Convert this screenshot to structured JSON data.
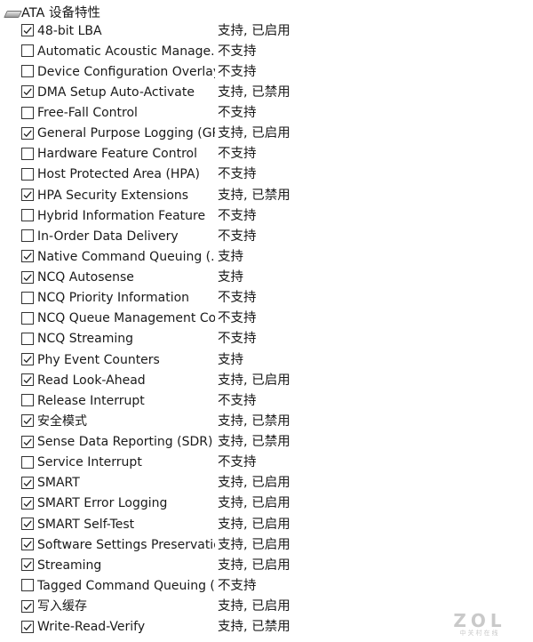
{
  "header": {
    "icon": "drive-icon",
    "title": "ATA 设备特性"
  },
  "features": [
    {
      "name": "48-bit LBA",
      "checked": true,
      "status": "支持, 已启用"
    },
    {
      "name": "Automatic Acoustic Manage...",
      "checked": false,
      "status": "不支持"
    },
    {
      "name": "Device Configuration Overlay...",
      "checked": false,
      "status": "不支持"
    },
    {
      "name": "DMA Setup Auto-Activate",
      "checked": true,
      "status": "支持, 已禁用"
    },
    {
      "name": "Free-Fall Control",
      "checked": false,
      "status": "不支持"
    },
    {
      "name": "General Purpose Logging (GP...",
      "checked": true,
      "status": "支持, 已启用"
    },
    {
      "name": "Hardware Feature Control",
      "checked": false,
      "status": "不支持"
    },
    {
      "name": "Host Protected Area (HPA)",
      "checked": false,
      "status": "不支持"
    },
    {
      "name": "HPA Security Extensions",
      "checked": true,
      "status": "支持, 已禁用"
    },
    {
      "name": "Hybrid Information Feature",
      "checked": false,
      "status": "不支持"
    },
    {
      "name": "In-Order Data Delivery",
      "checked": false,
      "status": "不支持"
    },
    {
      "name": "Native Command Queuing (...",
      "checked": true,
      "status": "支持"
    },
    {
      "name": "NCQ Autosense",
      "checked": true,
      "status": "支持"
    },
    {
      "name": "NCQ Priority Information",
      "checked": false,
      "status": "不支持"
    },
    {
      "name": "NCQ Queue Management Co...",
      "checked": false,
      "status": "不支持"
    },
    {
      "name": "NCQ Streaming",
      "checked": false,
      "status": "不支持"
    },
    {
      "name": "Phy Event Counters",
      "checked": true,
      "status": "支持"
    },
    {
      "name": "Read Look-Ahead",
      "checked": true,
      "status": "支持, 已启用"
    },
    {
      "name": "Release Interrupt",
      "checked": false,
      "status": "不支持"
    },
    {
      "name": "安全模式",
      "checked": true,
      "status": "支持, 已禁用"
    },
    {
      "name": "Sense Data Reporting (SDR)",
      "checked": true,
      "status": "支持, 已禁用"
    },
    {
      "name": "Service Interrupt",
      "checked": false,
      "status": "不支持"
    },
    {
      "name": "SMART",
      "checked": true,
      "status": "支持, 已启用"
    },
    {
      "name": "SMART Error Logging",
      "checked": true,
      "status": "支持, 已启用"
    },
    {
      "name": "SMART Self-Test",
      "checked": true,
      "status": "支持, 已启用"
    },
    {
      "name": "Software Settings Preservatio...",
      "checked": true,
      "status": "支持, 已启用"
    },
    {
      "name": "Streaming",
      "checked": true,
      "status": "支持, 已启用"
    },
    {
      "name": "Tagged Command Queuing (...",
      "checked": false,
      "status": "不支持"
    },
    {
      "name": "写入缓存",
      "checked": true,
      "status": "支持, 已启用"
    },
    {
      "name": "Write-Read-Verify",
      "checked": true,
      "status": "支持, 已禁用"
    }
  ],
  "watermark": {
    "logo": "ZOL",
    "subtitle": "中关村在线"
  }
}
